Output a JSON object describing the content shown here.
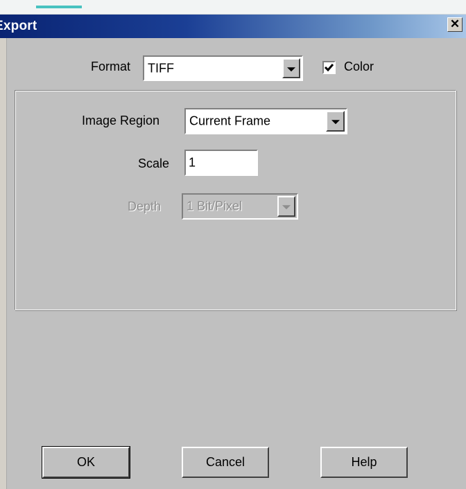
{
  "window": {
    "title": "Export",
    "close_glyph": "✕"
  },
  "format": {
    "label": "Format",
    "value": "TIFF",
    "color_checkbox": {
      "label": "Color",
      "checked": true
    }
  },
  "group": {
    "image_region": {
      "label": "Image Region",
      "value": "Current Frame"
    },
    "scale": {
      "label": "Scale",
      "value": "1"
    },
    "depth": {
      "label": "Depth",
      "value": "1 Bit/Pixel",
      "enabled": false
    }
  },
  "buttons": {
    "ok": "OK",
    "cancel": "Cancel",
    "help": "Help"
  },
  "icons": {
    "dropdown": "chevron-down-icon",
    "check": "checkmark-icon",
    "close": "close-icon"
  },
  "colors": {
    "title_gradient_start": "#0a2473",
    "title_gradient_end": "#a8c6e8",
    "dialog_bg": "#c0c0c0"
  }
}
